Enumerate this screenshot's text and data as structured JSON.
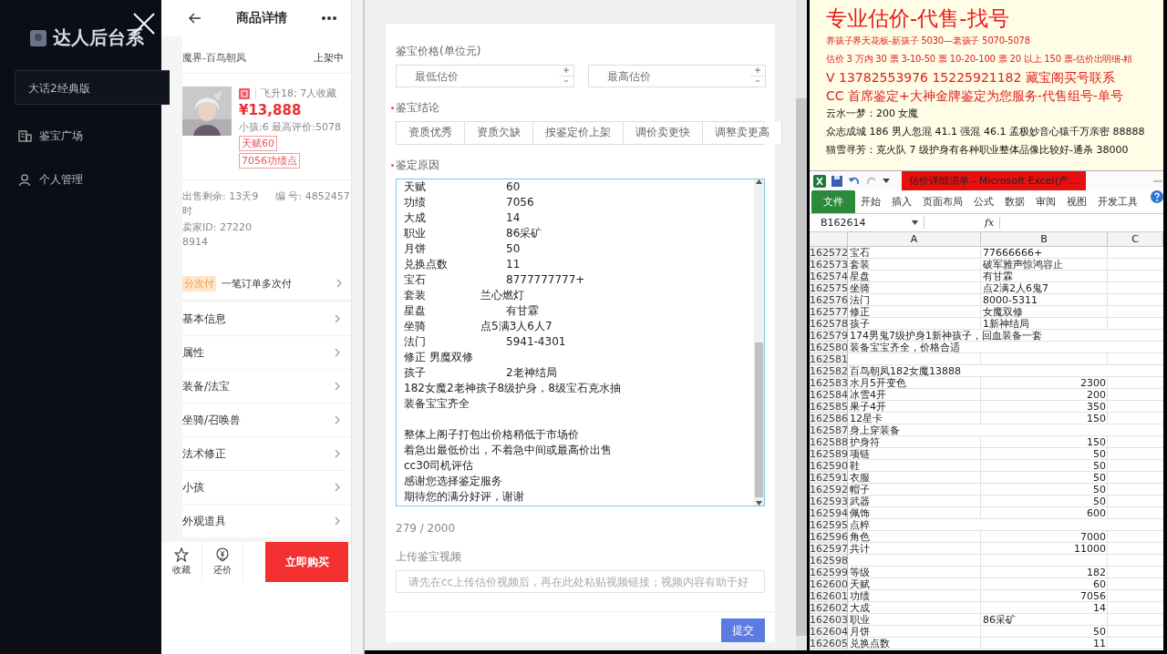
{
  "sidebar": {
    "logo": "达人后台系",
    "game_select": "大话2经典版",
    "items": [
      {
        "label": "鉴宝广场",
        "kind": "building"
      },
      {
        "label": "个人管理",
        "kind": "user"
      }
    ]
  },
  "product": {
    "title": "商品详情",
    "server": "魔界-百鸟朝凤",
    "status": "上架中",
    "stats": "飞升18; 7人收藏",
    "price": "¥13,888",
    "summary": "小孩:6 最高评价:5078",
    "tags": [
      "天赋60",
      "7056功绩点"
    ],
    "remaining": "出售剩余: 13天9时",
    "number": "编 号: 4852457",
    "seller": "卖家ID: 272208914",
    "installment": {
      "tag": "分次付",
      "text": "一笔订单多次付"
    },
    "menu": [
      "基本信息",
      "属性",
      "装备/法宝",
      "坐骑/召唤兽",
      "法术修正",
      "小孩",
      "外观道具"
    ],
    "actions": [
      {
        "kind": "star",
        "label": "收藏"
      },
      {
        "kind": "bid",
        "label": "还价"
      }
    ],
    "buy": "立即购买"
  },
  "form": {
    "price_label": "鉴宝价格(单位元)",
    "price_inputs": [
      {
        "placeholder": "最低估价"
      },
      {
        "placeholder": "最高估价"
      }
    ],
    "conclusion": {
      "label": "鉴宝结论",
      "required": true,
      "options": [
        {
          "label": "资质优秀",
          "selected": false
        },
        {
          "label": "资质欠缺",
          "selected": false
        },
        {
          "label": "按鉴定价上架",
          "selected": false
        },
        {
          "label": "调价卖更快",
          "selected": false
        },
        {
          "label": "调整卖更高",
          "selected": false
        }
      ]
    },
    "reason": {
      "label": "鉴定原因",
      "required": true,
      "lines": [
        {
          "kind": "text",
          "text": "天赋\t\t\t\t60"
        },
        {
          "kind": "text",
          "text": "功绩\t\t\t\t7056"
        },
        {
          "kind": "text",
          "text": "大成\t\t\t\t14"
        },
        {
          "kind": "text",
          "text": "职业\t\t\t\t86采矿"
        },
        {
          "kind": "text",
          "text": "月饼\t\t\t\t50"
        },
        {
          "kind": "text",
          "text": "兑换点数\t\t\t11"
        },
        {
          "kind": "text",
          "text": "宝石\t\t\t\t8777777777+"
        },
        {
          "kind": "text",
          "text": "套装\t\t\t兰心燃灯"
        },
        {
          "kind": "text",
          "text": "星盘\t\t\t\t有甘霖"
        },
        {
          "kind": "text",
          "text": "坐骑\t\t\t点5满3人6人7"
        },
        {
          "kind": "text",
          "text": "法门\t\t\t\t5941-4301"
        },
        {
          "kind": "text",
          "text": "修正 男魔双修"
        },
        {
          "kind": "text",
          "text": "孩子\t\t\t\t2老神结局"
        },
        {
          "kind": "text",
          "text": "182女魔2老神孩子8级护身，8级宝石克水抽"
        },
        {
          "kind": "text",
          "text": "装备宝宝齐全"
        },
        {
          "kind": "blank"
        },
        {
          "kind": "text",
          "text": "整体上阁子打包出价格稍低于市场价"
        },
        {
          "kind": "text",
          "text": "着急出最低价出，不着急中间或最高价出售"
        },
        {
          "kind": "text",
          "text": "cc30司机评估"
        },
        {
          "kind": "text",
          "text": "感谢您选择鉴定服务"
        },
        {
          "kind": "text",
          "text": "期待您的满分好评，谢谢"
        }
      ]
    },
    "counter": "279 / 2000",
    "video": {
      "label": "上传鉴宝视频",
      "placeholder": "请先在cc上传估价视频后，再在此处粘贴视频链接；视频内容有助于好"
    },
    "submit": "提交"
  },
  "document": {
    "lines": [
      {
        "kind": "title",
        "text": "专业估价-代售-找号"
      },
      {
        "kind": "red",
        "text": "养孩子界天花板-新孩子 5030—老孩子 5070-5078"
      },
      {
        "kind": "red",
        "text": "估价 3 万内 30 票 3-10-50 票 10-20-100 票 20 以上 150 票-估价出明细-精"
      },
      {
        "kind": "red_large",
        "text": "V 13782553976   15225921182  藏宝阁买号联系"
      },
      {
        "kind": "red_large",
        "text": "CC 首席鉴定+大神金牌鉴定为您服务-代售组号-单号"
      },
      {
        "kind": "black",
        "text": "云水一梦：200 女魔"
      },
      {
        "kind": "black",
        "text": "众志成城 186 男人忽混 41.1 强混 46.1 孟极妙音心猿千万亲密 88888"
      },
      {
        "kind": "black",
        "text": "猫雪寻芳：克火队 7 级护身有各种职业整体品像比较好-通杀 38000"
      }
    ]
  },
  "excel": {
    "title": "估价详细清单 - Microsoft Excel(产…",
    "tabs": [
      {
        "label": "文件",
        "kind": "file"
      },
      {
        "label": "开始",
        "kind": "tab"
      },
      {
        "label": "插入",
        "kind": "tab"
      },
      {
        "label": "页面布局",
        "kind": "tab"
      },
      {
        "label": "公式",
        "kind": "tab"
      },
      {
        "label": "数据",
        "kind": "tab"
      },
      {
        "label": "审阅",
        "kind": "tab"
      },
      {
        "label": "视图",
        "kind": "tab"
      },
      {
        "label": "开发工具",
        "kind": "tab"
      }
    ],
    "name_box": "B162614",
    "fx": "fx",
    "columns": [
      "A",
      "B",
      "C"
    ],
    "rows": [
      {
        "n": "162572",
        "a": "宝石",
        "b": "77666666+",
        "kind": "text"
      },
      {
        "n": "162573",
        "a": "套装",
        "b": "破军雅声惊鸿容止",
        "kind": "text"
      },
      {
        "n": "162574",
        "a": "星盘",
        "b": "有甘霖",
        "kind": "text"
      },
      {
        "n": "162575",
        "a": "坐骑",
        "b": "点2满2人6鬼7",
        "kind": "text"
      },
      {
        "n": "162576",
        "a": "法门",
        "b": "8000-5311",
        "kind": "text"
      },
      {
        "n": "162577",
        "a": "修正",
        "b": "女魔双修",
        "kind": "text"
      },
      {
        "n": "162578",
        "a": "孩子",
        "b": "1新神结局",
        "kind": "text"
      },
      {
        "n": "162579",
        "a": "174男鬼7级护身1新神孩子，回血装备一套"
      },
      {
        "n": "162580",
        "a": "装备宝宝齐全，价格合适"
      },
      {
        "n": "162581"
      },
      {
        "n": "162582",
        "a": "百鸟朝凤182女魔13888"
      },
      {
        "n": "162583",
        "a": "水月5开变色",
        "b": "2300",
        "kind": "number"
      },
      {
        "n": "162584",
        "a": "冰雪4开",
        "b": "200",
        "kind": "number"
      },
      {
        "n": "162585",
        "a": "果子4开",
        "b": "350",
        "kind": "number"
      },
      {
        "n": "162586",
        "a": "12星卡",
        "b": "150",
        "kind": "number"
      },
      {
        "n": "162587",
        "a": "身上穿装备"
      },
      {
        "n": "162588",
        "a": "护身符",
        "b": "150",
        "kind": "number"
      },
      {
        "n": "162589",
        "a": "项链",
        "b": "50",
        "kind": "number"
      },
      {
        "n": "162590",
        "a": "鞋",
        "b": "50",
        "kind": "number"
      },
      {
        "n": "162591",
        "a": "衣服",
        "b": "50",
        "kind": "number"
      },
      {
        "n": "162592",
        "a": "帽子",
        "b": "50",
        "kind": "number"
      },
      {
        "n": "162593",
        "a": "武器",
        "b": "50",
        "kind": "number"
      },
      {
        "n": "162594",
        "a": "佩饰",
        "b": "600",
        "kind": "number"
      },
      {
        "n": "162595",
        "a": "点粹"
      },
      {
        "n": "162596",
        "a": "角色",
        "b": "7000",
        "kind": "number"
      },
      {
        "n": "162597",
        "a": "共计",
        "b": "11000",
        "kind": "number"
      },
      {
        "n": "162598"
      },
      {
        "n": "162599",
        "a": "等级",
        "b": "182",
        "kind": "number"
      },
      {
        "n": "162600",
        "a": "天赋",
        "b": "60",
        "kind": "number"
      },
      {
        "n": "162601",
        "a": "功绩",
        "b": "7056",
        "kind": "number"
      },
      {
        "n": "162602",
        "a": "大成",
        "b": "14",
        "kind": "number"
      },
      {
        "n": "162603",
        "a": "职业",
        "b": "86采矿",
        "kind": "text"
      },
      {
        "n": "162604",
        "a": "月饼",
        "b": "50",
        "kind": "number"
      },
      {
        "n": "162605",
        "a": "兑换点数",
        "b": "11",
        "kind": "number"
      }
    ]
  }
}
